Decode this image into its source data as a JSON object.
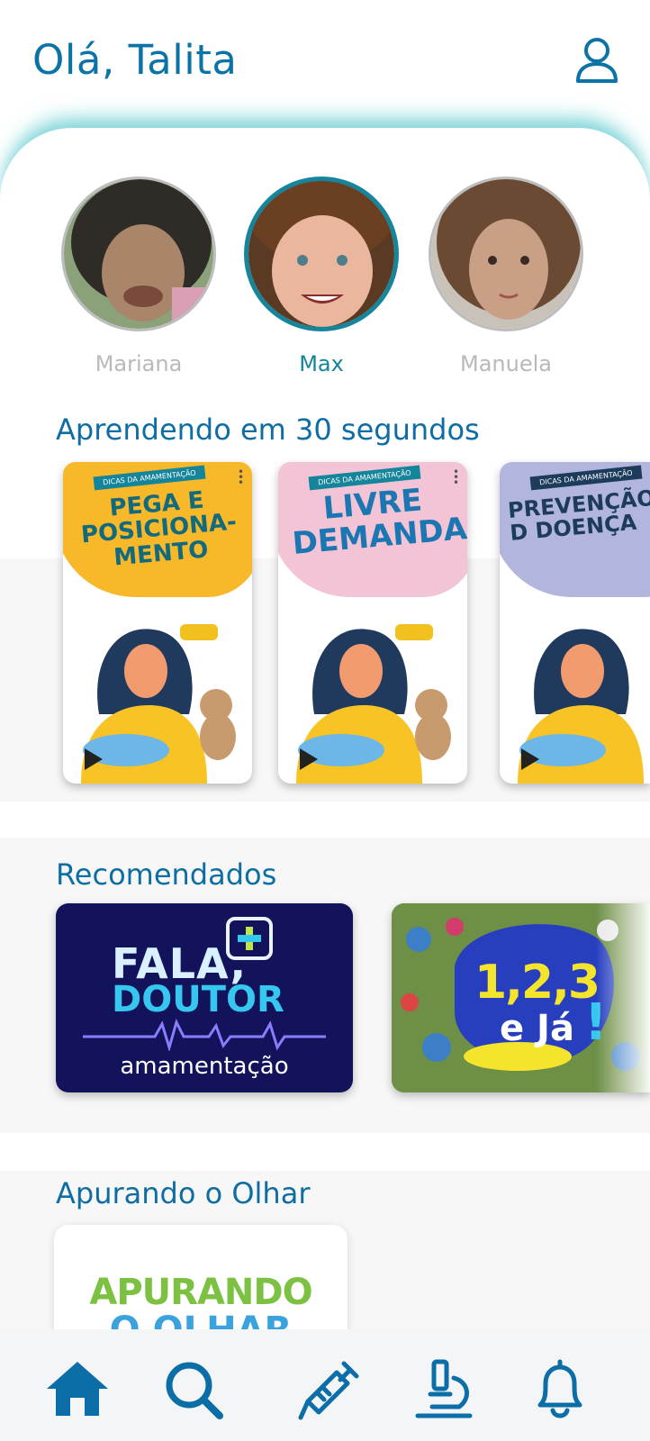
{
  "header": {
    "greeting": "Olá, Talita",
    "profile_icon": "user-icon"
  },
  "children": [
    {
      "name": "Mariana",
      "active": false
    },
    {
      "name": "Max",
      "active": true
    },
    {
      "name": "Manuela",
      "active": false
    }
  ],
  "shorts": {
    "title": "Aprendendo em 30 segundos",
    "cards": [
      {
        "tag": "DICAS DA AMAMENTAÇÃO",
        "title": "PEGA E POSICIONA-MENTO",
        "bg": "#f7b82a"
      },
      {
        "tag": "DICAS DA AMAMENTAÇÃO",
        "title": "LIVRE DEMANDA",
        "bg": "#f2c4d6"
      },
      {
        "tag": "DICAS DA AMAMENTAÇÃO",
        "title": "PREVENÇÃO D DOENÇA",
        "bg": "#b3b6dc"
      }
    ]
  },
  "recommended": {
    "title": "Recomendados",
    "cards": [
      {
        "line1": "FALA,",
        "line2": "DOUTOR",
        "line3": "amamentação"
      },
      {
        "line1": "1,2,3",
        "line2": "e Já",
        "line3": "!"
      }
    ]
  },
  "apurando": {
    "title": "Apurando o Olhar",
    "logo_line1": "APURANDO",
    "logo_line2": "O OLHAR"
  },
  "nav": {
    "items": [
      "home-icon",
      "search-icon",
      "vaccine-icon",
      "microscope-icon",
      "bell-icon"
    ],
    "accent": "#0c6ea6"
  },
  "colors": {
    "primary": "#0c73a6",
    "teal": "#14859a",
    "glow": "#46c4c4"
  }
}
